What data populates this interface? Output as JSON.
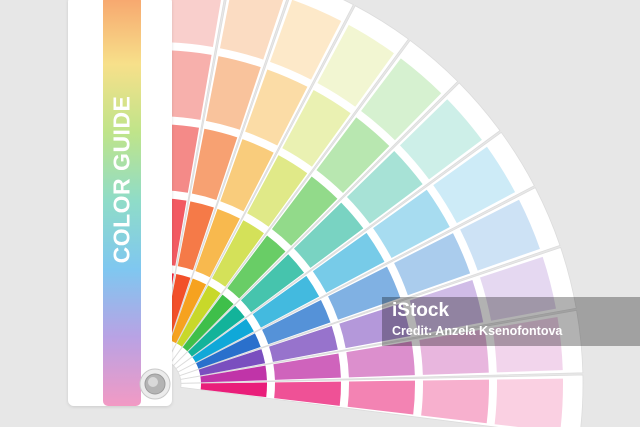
{
  "guide": {
    "label": "COLOR GUIDE",
    "stripe_colors": [
      "#f7a56e",
      "#f7e08a",
      "#bfe48a",
      "#8fdcc8",
      "#7fc7f0",
      "#b9a2e4",
      "#f29ac4"
    ]
  },
  "swatch_colors": [
    [
      "#f2273f",
      "#f25a62",
      "#f48a88",
      "#f7b0ac",
      "#f9cfcc"
    ],
    [
      "#f2502a",
      "#f57a48",
      "#f7a172",
      "#f9c39c",
      "#fbdcc2"
    ],
    [
      "#f6a21f",
      "#f8b94e",
      "#f9cc7c",
      "#fbdca6",
      "#fde9c9"
    ],
    [
      "#c8d82a",
      "#d4e159",
      "#e0e988",
      "#eaf1b2",
      "#f2f6d2"
    ],
    [
      "#3fbf4a",
      "#69cd66",
      "#92da8a",
      "#b8e7b0",
      "#d6f1d0"
    ],
    [
      "#13b39a",
      "#46c4ad",
      "#79d3c2",
      "#a7e2d6",
      "#cdefe8"
    ],
    [
      "#10a8d8",
      "#43badf",
      "#77cbe8",
      "#a7dcf0",
      "#cdebf7"
    ],
    [
      "#2a70cc",
      "#5592d8",
      "#80b1e3",
      "#aacced",
      "#cde2f5"
    ],
    [
      "#7a4fbf",
      "#9773cc",
      "#b498da",
      "#d0bce7",
      "#e5d8f1"
    ],
    [
      "#c034a8",
      "#cf63bc",
      "#dc8fcd",
      "#e8b6de",
      "#f2d5ec"
    ],
    [
      "#e91e7a",
      "#ef5196",
      "#f383b3",
      "#f7b0ce",
      "#fad0e2"
    ]
  ],
  "watermark": {
    "logo": "iStock",
    "credit": "Credit: Anzela Ksenofontova"
  }
}
